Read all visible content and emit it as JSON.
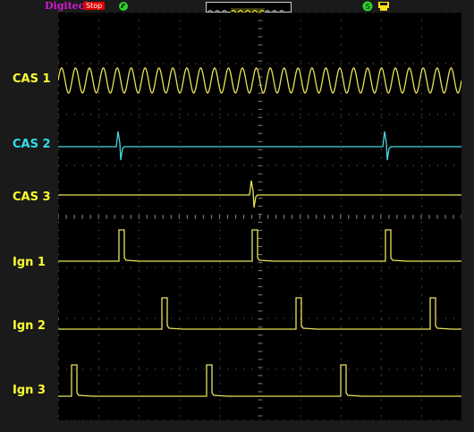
{
  "header": {
    "brand": "Digitech",
    "status": "Stop"
  },
  "channels": [
    {
      "label": "CAS 1",
      "color": "#ffff33"
    },
    {
      "label": "CAS 2",
      "color": "#33e0e8"
    },
    {
      "label": "CAS 3",
      "color": "#ffff33"
    },
    {
      "label": "Ign 1",
      "color": "#ffff33"
    },
    {
      "label": "Ign 2",
      "color": "#ffff33"
    },
    {
      "label": "Ign 3",
      "color": "#ffff33"
    }
  ],
  "colors": {
    "trace_yellow": "#e8e35a",
    "trace_cyan": "#4ad6e0",
    "grid": "#7a7a7a",
    "screen_bg": "#000000",
    "status_bg": "#e00000",
    "brand": "#d21bd2"
  }
}
